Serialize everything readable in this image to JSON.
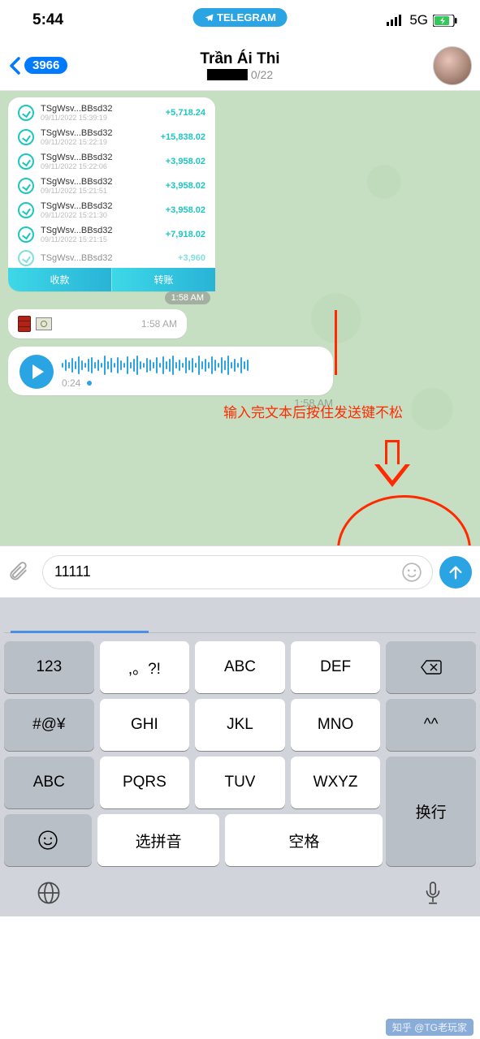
{
  "status": {
    "time": "5:44",
    "network": "5G",
    "app_pill": "TELEGRAM"
  },
  "header": {
    "back_count": "3966",
    "title": "Trần Ái Thi",
    "subtitle_suffix": "0/22"
  },
  "transactions": [
    {
      "name": "TSgWsv...BBsd32",
      "time": "09/11/2022 15:39:19",
      "amount": "+5,718.24"
    },
    {
      "name": "TSgWsv...BBsd32",
      "time": "09/11/2022 15:22:19",
      "amount": "+15,838.02"
    },
    {
      "name": "TSgWsv...BBsd32",
      "time": "09/11/2022 15:22:06",
      "amount": "+3,958.02"
    },
    {
      "name": "TSgWsv...BBsd32",
      "time": "09/11/2022 15:21:51",
      "amount": "+3,958.02"
    },
    {
      "name": "TSgWsv...BBsd32",
      "time": "09/11/2022 15:21:30",
      "amount": "+3,958.02"
    },
    {
      "name": "TSgWsv...BBsd32",
      "time": "09/11/2022 15:21:15",
      "amount": "+7,918.02"
    },
    {
      "name": "TSgWsv...BBsd32",
      "time": "",
      "amount": "+3,960"
    }
  ],
  "card_buttons": {
    "left": "收款",
    "right": "转账"
  },
  "timestamps": {
    "card": "1:58 AM",
    "emoji": "1:58 AM",
    "voice": "1:58 AM"
  },
  "voice": {
    "duration": "0:24"
  },
  "annotation_text": "输入完文本后按住发送键不松",
  "input": {
    "value": "11111"
  },
  "keyboard": {
    "rows": [
      [
        "123",
        ",。?!",
        "ABC",
        "DEF"
      ],
      [
        "#@¥",
        "GHI",
        "JKL",
        "MNO",
        "^^"
      ],
      [
        "ABC",
        "PQRS",
        "TUV",
        "WXYZ"
      ]
    ],
    "backspace": "⌫",
    "enter": "换行",
    "bottom": {
      "emoji": "☺",
      "pinyin": "选拼音",
      "space": "空格"
    }
  },
  "watermark": "知乎 @TG老玩家"
}
